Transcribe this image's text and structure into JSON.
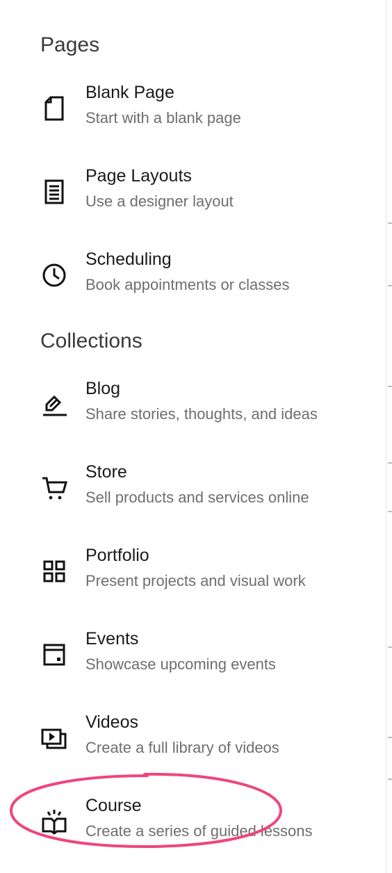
{
  "sections": {
    "pages": {
      "title": "Pages",
      "items": [
        {
          "title": "Blank Page",
          "description": "Start with a blank page",
          "icon": "blank-page-icon"
        },
        {
          "title": "Page Layouts",
          "description": "Use a designer layout",
          "icon": "layout-icon"
        },
        {
          "title": "Scheduling",
          "description": "Book appointments or classes",
          "icon": "clock-icon"
        }
      ]
    },
    "collections": {
      "title": "Collections",
      "items": [
        {
          "title": "Blog",
          "description": "Share stories, thoughts, and ideas",
          "icon": "pen-icon"
        },
        {
          "title": "Store",
          "description": "Sell products and services online",
          "icon": "cart-icon"
        },
        {
          "title": "Portfolio",
          "description": "Present projects and visual work",
          "icon": "grid-icon"
        },
        {
          "title": "Events",
          "description": "Showcase upcoming events",
          "icon": "calendar-icon"
        },
        {
          "title": "Videos",
          "description": "Create a full library of videos",
          "icon": "video-library-icon"
        },
        {
          "title": "Course",
          "description": "Create a series of guided lessons",
          "icon": "open-book-icon"
        }
      ]
    }
  },
  "colors": {
    "highlight": "#f0457a",
    "text_primary": "#1a1a1a",
    "text_secondary": "#6e6e6e",
    "heading": "#3a3a3a"
  }
}
